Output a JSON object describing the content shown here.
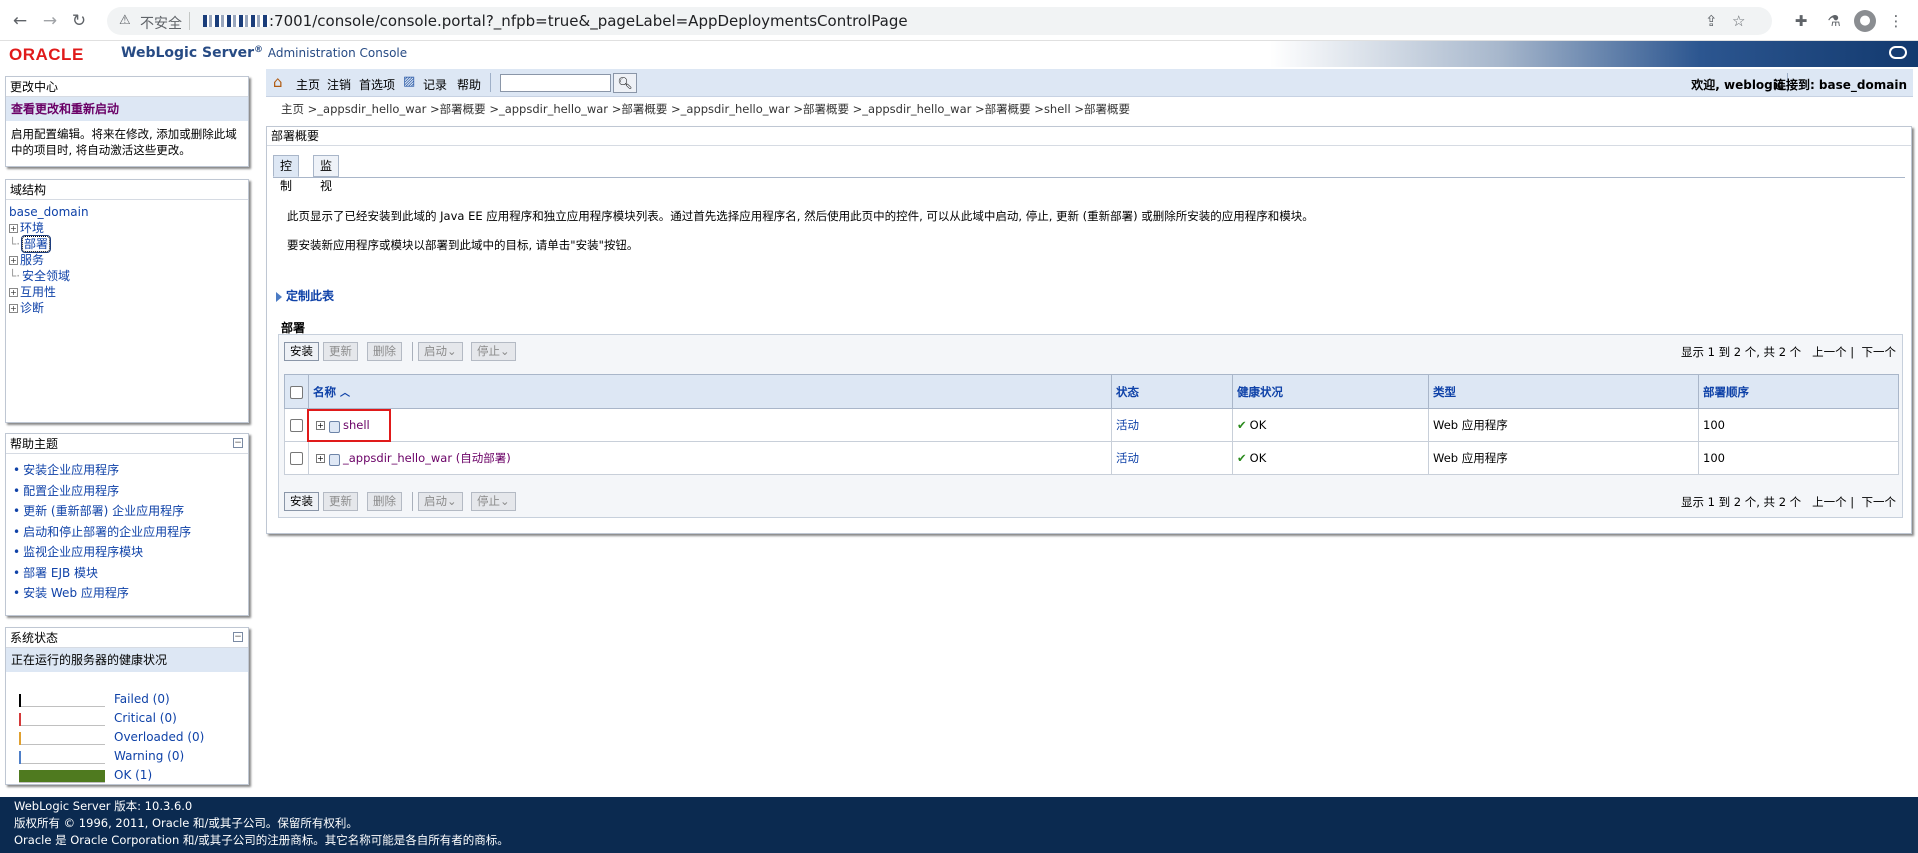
{
  "browser": {
    "security_label": "不安全",
    "url": ":7001/console/console.portal?_nfpb=true&_pageLabel=AppDeploymentsControlPage"
  },
  "header": {
    "oracle_logo": "ORACLE",
    "product": "WebLogic Server",
    "registered": "®",
    "console": "Administration Console"
  },
  "change_center": {
    "title": "更改中心",
    "link": "查看更改和重新启动",
    "description": "启用配置编辑。将来在修改, 添加或删除此域中的项目时, 将自动激活这些更改。"
  },
  "domain_structure": {
    "title": "域结构",
    "root": "base_domain",
    "nodes": [
      "环境",
      "部署",
      "服务",
      "安全领域",
      "互用性",
      "诊断"
    ]
  },
  "help_topics": {
    "title": "帮助主题",
    "items": [
      "安装企业应用程序",
      "配置企业应用程序",
      "更新 (重新部署) 企业应用程序",
      "启动和停止部署的企业应用程序",
      "监视企业应用程序模块",
      "部署 EJB 模块",
      "安装 Web 应用程序"
    ]
  },
  "system_status": {
    "title": "系统状态",
    "subtitle": "正在运行的服务器的健康状况",
    "rows": [
      {
        "label": "Failed (0)",
        "color": "#000000"
      },
      {
        "label": "Critical (0)",
        "color": "#d43a3a"
      },
      {
        "label": "Overloaded (0)",
        "color": "#e0a030"
      },
      {
        "label": "Warning (0)",
        "color": "#4f7fc8"
      },
      {
        "label": "OK (1)",
        "color": "#4f7a1f"
      }
    ]
  },
  "topnav": {
    "home": "主页",
    "logout": "注销",
    "preferences": "首选项",
    "record": "记录",
    "help": "帮助",
    "welcome": "欢迎, weblogic",
    "connected": "连接到: base_domain"
  },
  "breadcrumb": "主页 >_appsdir_hello_war >部署概要 >_appsdir_hello_war >部署概要 >_appsdir_hello_war >部署概要 >_appsdir_hello_war >部署概要 >shell >部署概要",
  "main": {
    "title": "部署概要",
    "tabs": [
      "控制",
      "监视"
    ],
    "intro1": "此页显示了已经安装到此域的 Java EE 应用程序和独立应用程序模块列表。通过首先选择应用程序名, 然后使用此页中的控件, 可以从此域中启动, 停止, 更新 (重新部署) 或删除所安装的应用程序和模块。",
    "intro2": "要安装新应用程序或模块以部署到此域中的目标, 请单击\"安装\"按钮。",
    "customize": "定制此表",
    "deployments_label": "部署",
    "buttons": {
      "install": "安装",
      "update": "更新",
      "delete": "删除",
      "start": "启动",
      "stop": "停止"
    },
    "pager": {
      "summary": "显示 1 到 2 个, 共 2 个",
      "prev": "上一个",
      "next": "下一个"
    },
    "columns": [
      "名称",
      "状态",
      "健康状况",
      "类型",
      "部署顺序"
    ],
    "rows": [
      {
        "name": "shell",
        "state": "活动",
        "health": "OK",
        "type": "Web 应用程序",
        "order": "100"
      },
      {
        "name": "_appsdir_hello_war (自动部署)",
        "state": "活动",
        "health": "OK",
        "type": "Web 应用程序",
        "order": "100"
      }
    ]
  },
  "footer": {
    "line1": "WebLogic Server 版本: 10.3.6.0",
    "line2": "版权所有 © 1996, 2011, Oracle 和/或其子公司。保留所有权利。",
    "line3": "Oracle 是 Oracle Corporation 和/或其子公司的注册商标。其它名称可能是各自所有者的商标。"
  }
}
